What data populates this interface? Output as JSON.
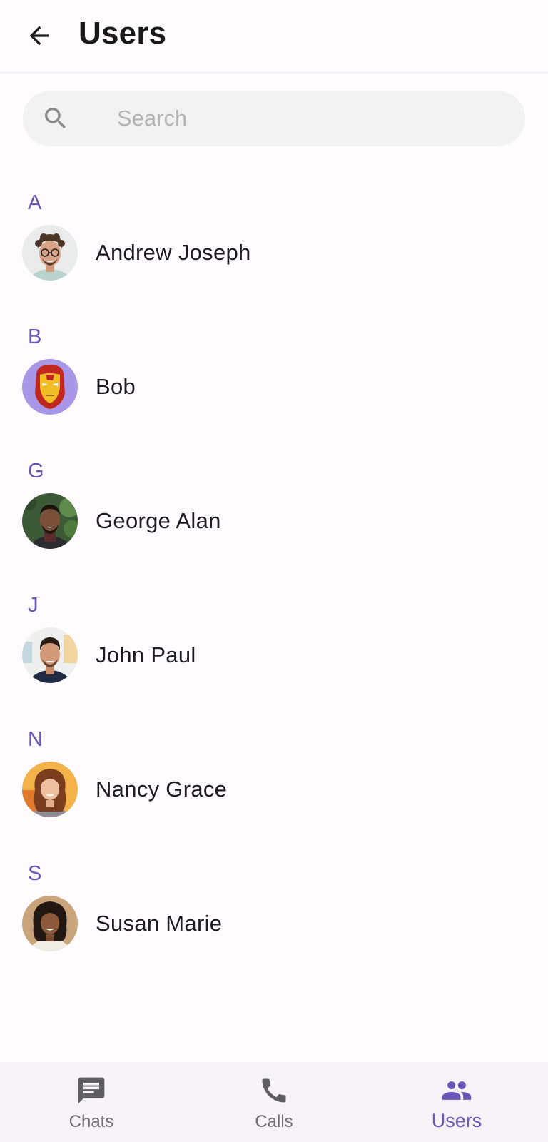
{
  "header": {
    "title": "Users"
  },
  "search": {
    "placeholder": "Search",
    "value": ""
  },
  "sections": [
    {
      "letter": "A",
      "user": {
        "name": "Andrew Joseph",
        "avatar": "photo-man-curly-hair-glasses"
      }
    },
    {
      "letter": "B",
      "user": {
        "name": "Bob",
        "avatar": "iron-man-helmet"
      }
    },
    {
      "letter": "G",
      "user": {
        "name": "George Alan",
        "avatar": "photo-man-beard-dark-sweater"
      }
    },
    {
      "letter": "J",
      "user": {
        "name": "John Paul",
        "avatar": "photo-man-smiling-navy-shirt"
      }
    },
    {
      "letter": "N",
      "user": {
        "name": "Nancy Grace",
        "avatar": "photo-woman-curly-red-hair"
      }
    },
    {
      "letter": "S",
      "user": {
        "name": "Susan Marie",
        "avatar": "photo-woman-curly-dark-hair"
      }
    }
  ],
  "bottom_nav": {
    "items": [
      {
        "label": "Chats",
        "icon": "chat-icon",
        "active": false
      },
      {
        "label": "Calls",
        "icon": "phone-icon",
        "active": false
      },
      {
        "label": "Users",
        "icon": "users-icon",
        "active": true
      }
    ]
  },
  "colors": {
    "accent": "#6a55b8",
    "background": "#fffbff",
    "search_bg": "#f2f2f2",
    "nav_bg": "#f7f1f9"
  }
}
